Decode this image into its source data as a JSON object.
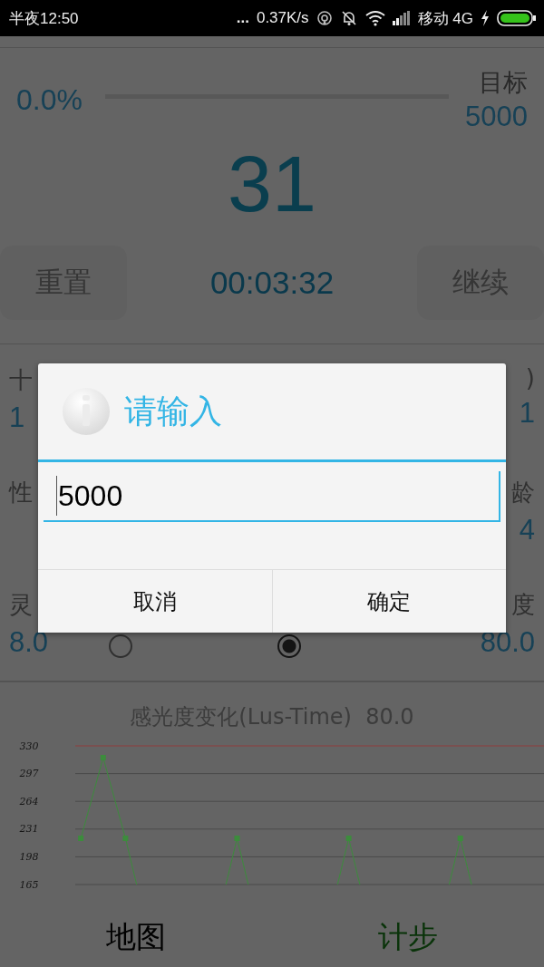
{
  "status_bar": {
    "time": "半夜12:50",
    "more": "...",
    "speed": "0.37K/s",
    "carrier": "移动 4G"
  },
  "progress": {
    "percent": "0.0%",
    "level": 0.0,
    "goal_label": "目标",
    "goal_value": "5000"
  },
  "steps": "31",
  "controls": {
    "reset": "重置",
    "timer": "00:03:32",
    "resume": "继续"
  },
  "stats_left": [
    {
      "label": "十",
      "value": "1"
    },
    {
      "label": "性"
    },
    {
      "label": "灵",
      "value": "8.0"
    }
  ],
  "stats_right": [
    {
      "label": ")",
      "value": "1"
    },
    {
      "label": "龄",
      "value": "4"
    },
    {
      "label": "度",
      "value": "80.0"
    }
  ],
  "modes": [
    {
      "selected": false
    },
    {
      "selected": true
    }
  ],
  "chart": {
    "chart_data": {
      "type": "line",
      "title": "感光度变化(Lus-Time)  80.0",
      "grid": true,
      "categories": [
        null,
        null,
        null,
        null,
        null,
        null,
        null,
        null,
        null,
        null,
        null,
        null,
        null,
        null,
        null,
        null,
        null,
        null,
        null,
        null,
        null,
        null,
        null,
        null,
        null,
        null,
        null,
        null,
        null,
        null,
        null,
        null,
        null,
        null,
        null,
        null,
        null,
        null,
        null,
        null,
        null,
        null
      ],
      "ylim": [
        165,
        330
      ],
      "yticks": [
        165,
        198,
        231,
        264,
        297,
        330
      ],
      "series": [
        {
          "color": "#3c8c3c",
          "values": [
            220,
            null,
            316,
            null,
            220,
            165,
            null,
            null,
            null,
            null,
            null,
            null,
            null,
            165,
            220,
            165,
            null,
            null,
            null,
            null,
            null,
            null,
            null,
            165,
            220,
            165,
            null,
            null,
            null,
            null,
            null,
            null,
            null,
            165,
            220,
            165,
            null,
            null,
            null,
            null,
            null,
            null
          ]
        }
      ]
    }
  },
  "bottom_nav": [
    {
      "label": "地图",
      "selected": false
    },
    {
      "label": "计步",
      "selected": true
    }
  ],
  "dialog": {
    "title": "请输入",
    "input_value": "5000",
    "buttons": [
      "取消",
      "确定"
    ]
  }
}
